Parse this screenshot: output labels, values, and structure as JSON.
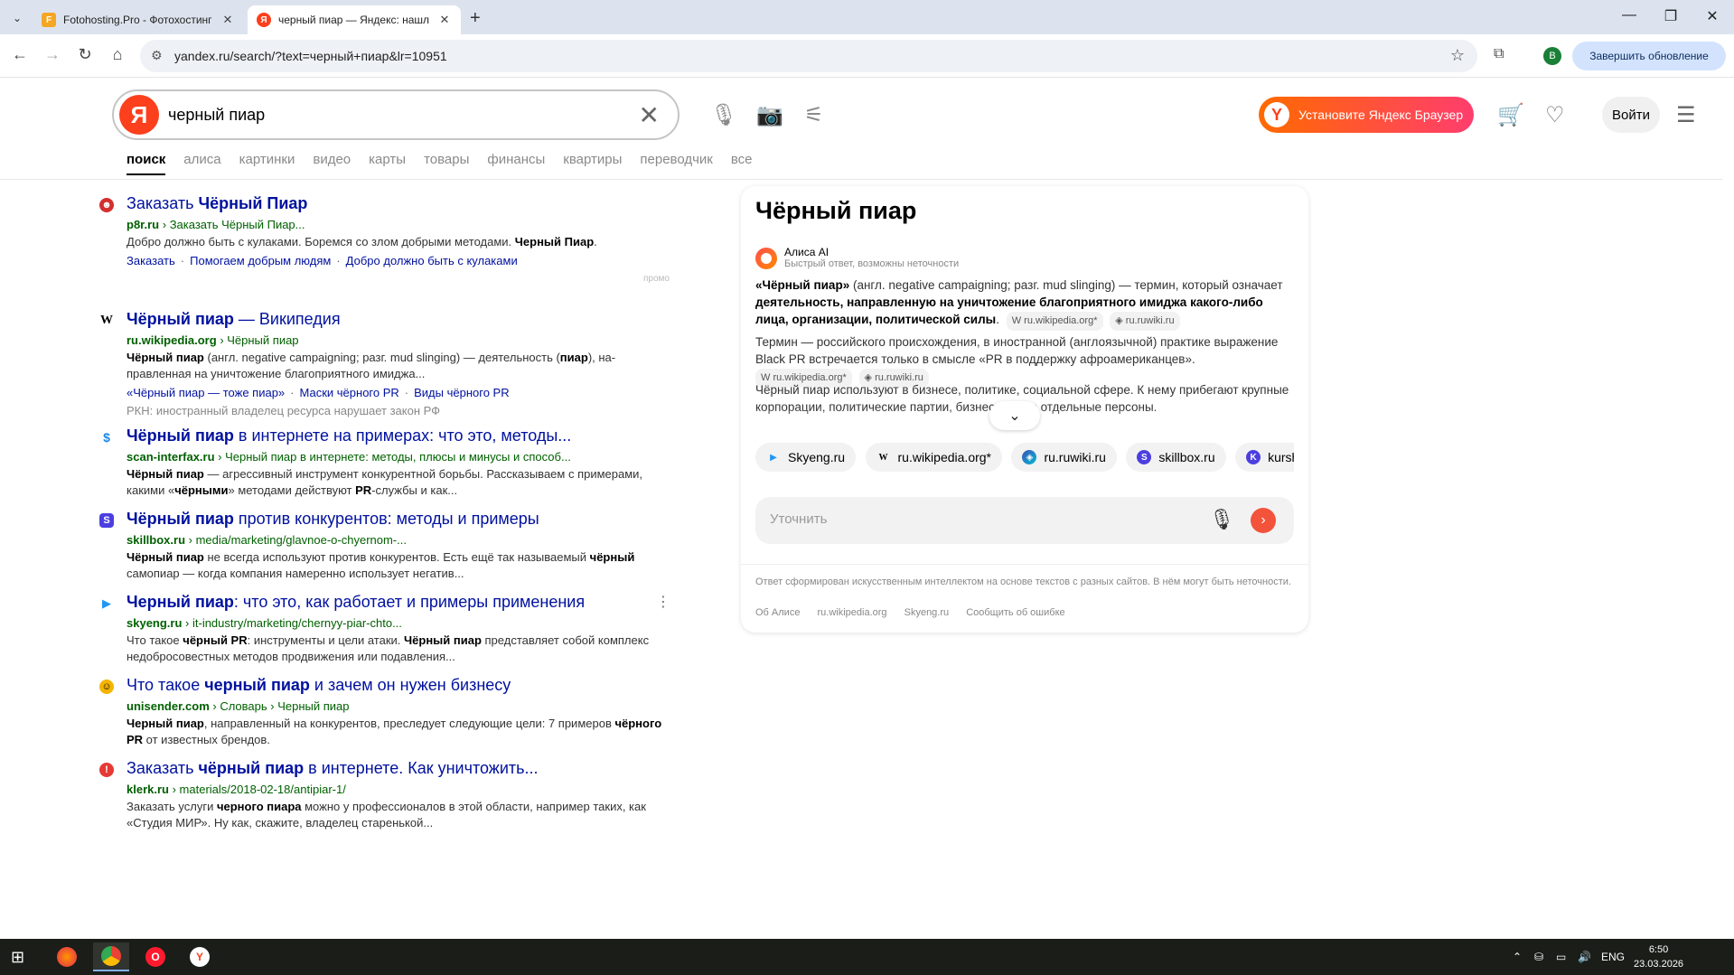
{
  "browser": {
    "tabs": [
      {
        "title": "Fotohosting.Pro - Фотохостинг",
        "favicon": "F"
      },
      {
        "title": "черный пиар — Яндекс: нашл",
        "favicon": "Я"
      }
    ],
    "url": "yandex.ru/search/?text=черный+пиар&lr=10951",
    "profile_initial": "В",
    "update_label": "Завершить обновление"
  },
  "yandex": {
    "logo": "Я",
    "query": "черный пиар",
    "promo_label": "Установите Яндекс Браузер",
    "login_label": "Войти",
    "tabs": [
      "поиск",
      "алиса",
      "картинки",
      "видео",
      "карты",
      "товары",
      "финансы",
      "квартиры",
      "переводчик",
      "все"
    ]
  },
  "results": [
    {
      "title_html": "Заказать <b>Чёрный Пиар</b>",
      "domain": "p8r.ru",
      "path": "› Заказать Чёрный Пиар...",
      "snippet_html": "Добро должно быть с кулаками. Боремся со злом добрыми методами. <b>Черный Пиар</b>.",
      "links": [
        "Заказать",
        "Помогаем добрым людям",
        "Добро должно быть с кулаками"
      ],
      "promo": "промо"
    },
    {
      "title_html": "<b>Чёрный пиар</b> — Википедия",
      "domain": "ru.wikipedia.org",
      "path": "› Чёрный пиар",
      "snippet_html": "<b>Чёрный пиар</b> (англ. negative campaigning; разг. mud slinging) — деятельность (<b>пиар</b>), на­правленная на уничтожение благоприятного имиджа...",
      "links": [
        "«Чёрный пиар — тоже пиар»",
        "Маски чёрного PR",
        "Виды чёрного PR"
      ],
      "note": "РКН: иностранный владелец ресурса нарушает закон РФ"
    },
    {
      "title_html": "<b>Чёрный пиар</b> в интернете на примерах: что это, методы...",
      "domain": "scan-interfax.ru",
      "path": "› Черный пиар в интернете: методы, плюсы и минусы и способ...",
      "snippet_html": "<b>Чёрный пиар</b> — агрессивный инструмент конкурентной борьбы. Рассказываем с приме­рами, какими «<b>чёрными</b>» методами действуют <b>PR</b>-службы и как..."
    },
    {
      "title_html": "<b>Чёрный пиар</b> против конкурентов: методы и примеры",
      "domain": "skillbox.ru",
      "path": "› media/marketing/glavnoe-o-chyernom-...",
      "snippet_html": "<b>Чёрный пиар</b> не всегда используют против конкурентов. Есть ещё так называемый <b>чёр­ный</b> самопиар — когда компания намеренно использует негатив..."
    },
    {
      "title_html": "<b>Черный пиар</b>: что это, как работает и примеры применения",
      "domain": "skyeng.ru",
      "path": "› it-industry/marketing/chernyy-piar-chto...",
      "snippet_html": "Что такое <b>чёрный PR</b>: инструменты и цели атаки. <b>Чёрный пиар</b> представляет собой ком­плекс недобросовестных методов продвижения или подавления..."
    },
    {
      "title_html": "Что такое <b>черный пиар</b> и зачем он нужен бизнесу",
      "domain": "unisender.com",
      "path": "› Словарь › Черный пиар",
      "snippet_html": "<b>Черный пиар</b>, направленный на конкурентов, преследует следующие цели: 7 примеров <b>чёрного PR</b> от известных брендов."
    },
    {
      "title_html": "Заказать <b>чёрный пиар</b> в интернете. Как уничтожить...",
      "domain": "klerk.ru",
      "path": "› materials/2018-02-18/antipiar-1/",
      "snippet_html": "Заказать услуги <b>черного пиара</b> можно у профессионалов в этой области, например таких, как «Студия МИР». Ну как, скажите, владелец старенькой..."
    }
  ],
  "panel": {
    "title": "Чёрный пиар",
    "alisa_name": "Алиса AI",
    "alisa_sub": "Быстрый ответ, возможны неточности",
    "para1_html": "<b>«Чёрный пиар»</b> (англ. negative campaigning; разг. mud slinging) — термин, который означает <b>деятельность, направленную на уничтожение благоприятного имиджа какого-либо лица, организации, политической силы</b>.",
    "para1_sources": [
      "ru.wikipedia.org*",
      "ru.ruwiki.ru"
    ],
    "para2_html": "Термин — российского происхождения, в иностранной (англоязычной) практике выражение Black PR встречается только в смысле «PR в поддержку афроамериканцев».",
    "para2_sources": [
      "ru.wikipedia.org*",
      "ru.ruwiki.ru"
    ],
    "para3_html": "Чёрный пиар используют в бизнесе, политике, социальной сфере. К нему прибегают крупные корпорации, политические партии, бизнес и даже отдельные персоны.",
    "chips": [
      "Skyeng.ru",
      "ru.wikipedia.org*",
      "ru.ruwiki.ru",
      "skillbox.ru",
      "kurshub.ru"
    ],
    "refine_placeholder": "Уточнить",
    "disclaimer": "Ответ сформирован искусственным интеллектом на основе текстов с разных сайтов. В нём могут быть неточности.",
    "footer_links": [
      "Об Алисе",
      "ru.wikipedia.org",
      "Skyeng.ru",
      "Сообщить об ошибке"
    ]
  },
  "taskbar": {
    "lang": "ENG",
    "time": "6:50",
    "date": "23.03.2026"
  }
}
